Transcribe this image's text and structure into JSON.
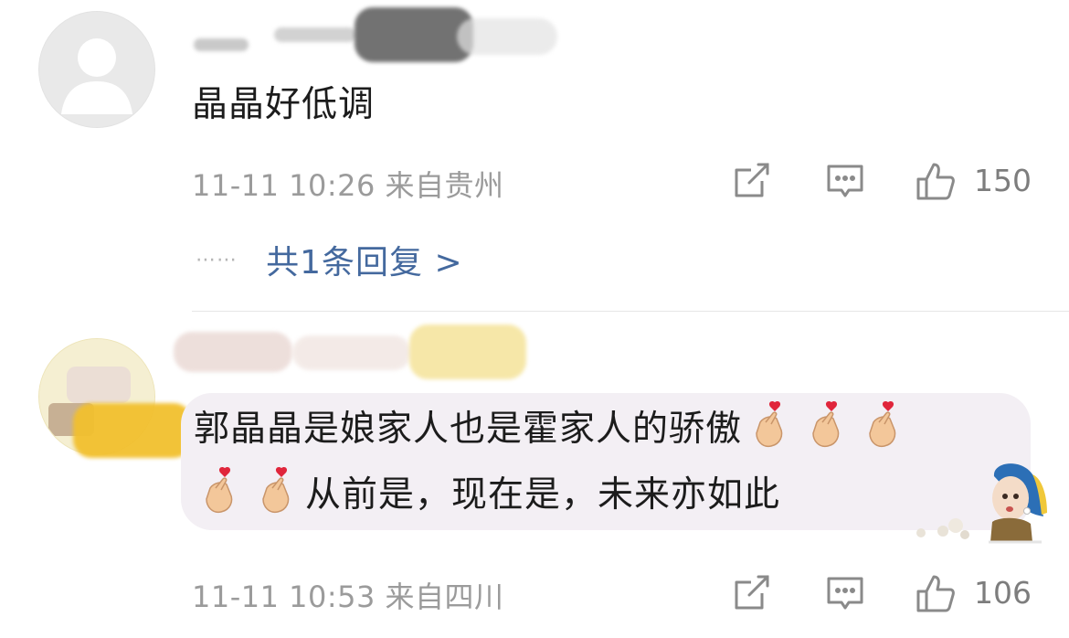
{
  "comments": [
    {
      "avatar_icon": "default-avatar-icon",
      "text": "晶晶好低调",
      "time": "11-11 10:26",
      "location": "来自贵州",
      "like_count": "150",
      "replies_label": "共1条回复 >",
      "dots": "⋯⋯"
    },
    {
      "avatar_icon": "user-avatar-icon",
      "text_line1": "郭晶晶是娘家人也是霍家人的骄傲",
      "text_line2": "从前是，现在是，未来亦如此",
      "time": "11-11 10:53",
      "location": "来自四川",
      "like_count": "106",
      "emoji_name": "finger-heart-emoji",
      "sticker_name": "pearl-earring-girl-sticker"
    }
  ],
  "icons": {
    "share": "share-icon",
    "reply": "comment-icon",
    "like": "thumbs-up-icon"
  },
  "colors": {
    "link": "#44699e",
    "meta": "#9b9b9b",
    "bubble": "#f3eff4",
    "icon": "#8a8a8a"
  }
}
